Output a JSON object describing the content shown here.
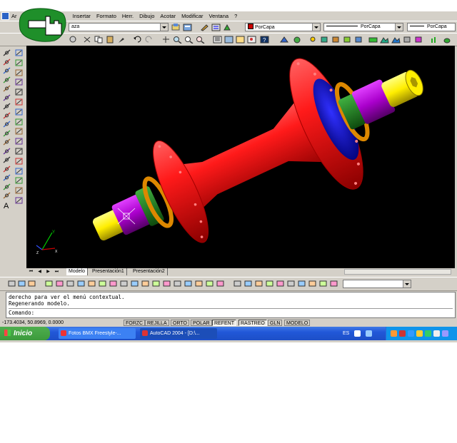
{
  "menu": {
    "items": [
      "Ar",
      "Insertar",
      "Formato",
      "Herr.",
      "Dibujo",
      "Acotar",
      "Modificar",
      "Ventana",
      "?"
    ]
  },
  "toolbar": {
    "layer_combo": "aza",
    "color_combo": "PorCapa",
    "linetype_combo": "PorCapa",
    "lineweight_combo": "PorCapa"
  },
  "layout_tabs": [
    "Modelo",
    "Presentación1",
    "Presentación2"
  ],
  "command": {
    "lines": [
      "derecho para ver el menú contextual.",
      "Regenerando modelo."
    ],
    "prompt": "Comando:"
  },
  "status": {
    "coords": "-173.4034, 50.8969, 0.0000",
    "toggles": [
      "FORZC",
      "REJILLA",
      "ORTO",
      "POLAR",
      "REFENT",
      "RASTREO",
      "GLN",
      "MODELO"
    ]
  },
  "taskbar": {
    "start": "Inicio",
    "tasks": [
      "Fotos BMX Freestyle-...",
      "AutoCAD 2004 - [D:\\..."
    ],
    "language": "ES"
  },
  "colors": {
    "hub_red": "#ff1a1a",
    "axle_yellow": "#ffee00",
    "nut_purple": "#aa00cc",
    "washer_orange": "#dd8800",
    "spacer_green": "#1e7a1e",
    "bearing_blue": "#1010d0",
    "viewport_bg": "#000000"
  },
  "icons": [
    "pointer-hand-sticker",
    "ucs-axis-icon",
    "crosshair-cursor"
  ]
}
